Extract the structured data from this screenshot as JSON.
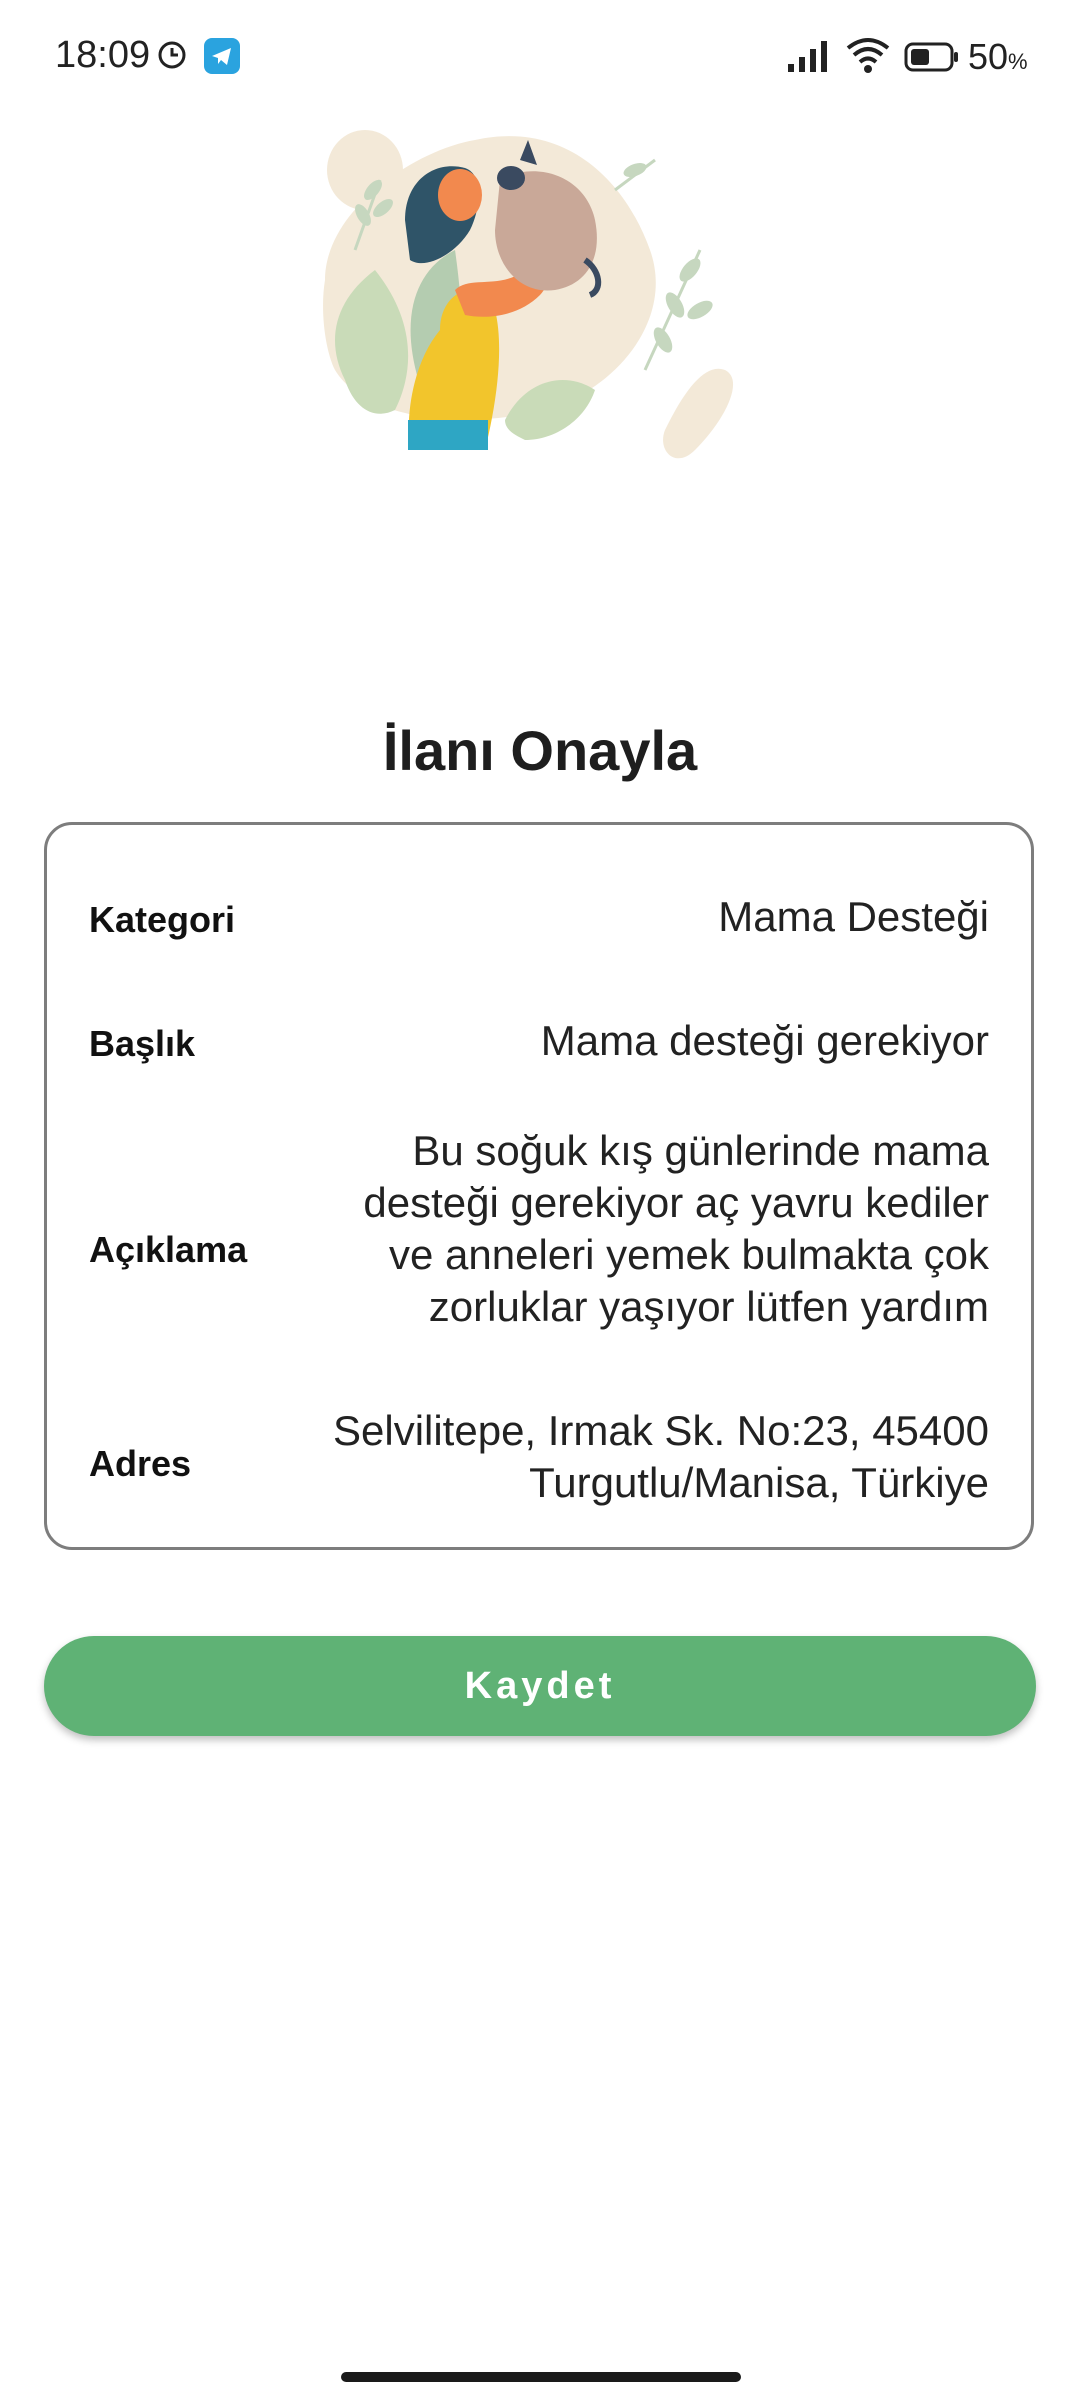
{
  "status_bar": {
    "time": "18:09",
    "battery_percent": "50",
    "battery_unit": "%",
    "icons": [
      "clock-icon",
      "telegram-icon",
      "signal-icon",
      "wifi-icon",
      "battery-icon"
    ]
  },
  "header": {
    "title": "İlanı Onayla"
  },
  "details": {
    "category_label": "Kategori",
    "category_value": "Mama Desteği",
    "title_label": "Başlık",
    "title_value": "Mama desteği gerekiyor",
    "description_label": "Açıklama",
    "description_value": "Bu soğuk kış günlerinde mama desteği gerekiyor aç yavru kediler ve anneleri yemek bulmakta çok zorluklar yaşıyor lütfen yardım",
    "address_label": "Adres",
    "address_value": "Selvilitepe, Irmak Sk. No:23, 45400 Turgutlu/Manisa, Türkiye"
  },
  "actions": {
    "save_label": "Kaydet"
  },
  "colors": {
    "accent_green": "#5fb275",
    "card_border": "#7d7d7d",
    "blob_beige": "#f3e9d8",
    "telegram_blue": "#2aa3df"
  }
}
